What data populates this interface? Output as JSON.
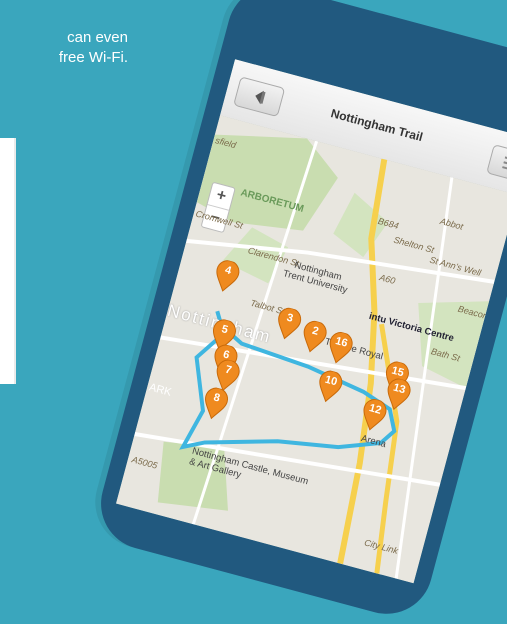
{
  "background_text": {
    "line1": "can even",
    "line2": "free Wi-Fi."
  },
  "app": {
    "title": "Nottingham Trail"
  },
  "map": {
    "zoom_in": "+",
    "zoom_out": "−",
    "labels": {
      "arboretum": "ARBORETUM",
      "cromwell": "Cromwell St",
      "clarendon": "Clarendon St",
      "university": "Nottingham Trent University",
      "talbot": "Talbot St",
      "nottingham": "Nottingham",
      "theatre": "Theatre Royal",
      "victoria": "intu Victoria Centre",
      "bath": "Bath St",
      "shelton": "Shelton St",
      "b684": "B684",
      "a60": "A60",
      "abbot": "Abbot",
      "st_anns": "St Ann's Well",
      "beacon": "Beacon Hill",
      "arena": "Arena",
      "castle": "Nottingham Castle, Museum & Art Gallery",
      "a5005": "A5005",
      "city_link": "City Link",
      "ark": "ARK",
      "mansfield": "sfield"
    },
    "markers": [
      "4",
      "3",
      "2",
      "16",
      "5",
      "6",
      "7",
      "8",
      "10",
      "15",
      "13",
      "12"
    ]
  },
  "colors": {
    "background": "#3aa6bd",
    "phone": "#21597f",
    "route": "#3fb6e0",
    "marker": "#ef8a1f"
  }
}
